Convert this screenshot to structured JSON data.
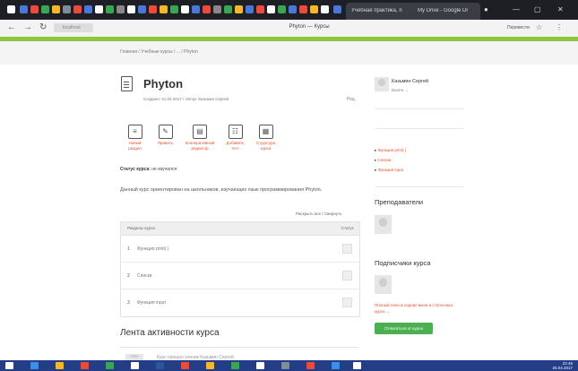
{
  "browser": {
    "active_tab_title": "Учебная практика, п",
    "second_tab_title": "My Drive - Google Dr",
    "address": "localhost",
    "page_title": "Phyton — Курсы",
    "translate_label": "Перевести"
  },
  "breadcrumb": "Главная  /  Учебные курсы  /  ...  /  Phyton",
  "course": {
    "title": "Phyton",
    "meta": "Создано: 21.04.2017  /  Автор: Казьмин Сергей",
    "ref_label": "Ред."
  },
  "actions": [
    {
      "label": "Новый раздел",
      "icon": "new-section-icon",
      "glyph": "≡"
    },
    {
      "label": "Править",
      "icon": "edit-icon",
      "glyph": "✎"
    },
    {
      "label": "Кооперативный редактор",
      "icon": "coop-editor-icon",
      "glyph": "▤"
    },
    {
      "label": "Добавить тест",
      "icon": "add-test-icon",
      "glyph": "☷"
    },
    {
      "label": "Структура курса",
      "icon": "course-structure-icon",
      "glyph": "▦"
    }
  ],
  "status": {
    "label": "Статус курса:",
    "value": "не изучался"
  },
  "description": "Данный курс ориентирован на школьников, изучающих язык программирования Phyton.",
  "expand_link": "Раскрыть все / Свернуть",
  "sections_table": {
    "col_sections": "Разделы курса",
    "col_status": "Статус",
    "rows": [
      {
        "num": "1",
        "name": "Функция print( )"
      },
      {
        "num": "2",
        "name": "Списки"
      },
      {
        "num": "3",
        "name": "Функция input"
      }
    ]
  },
  "feed": {
    "title": "Лента активности курса",
    "snippet": "Курс прошел ученик Казьмин Сергей"
  },
  "sidebar": {
    "user_name": "Казьмин Сергей",
    "user_link": "Выйти  →",
    "links": [
      "Функция print( )",
      "Списки",
      "Функция input"
    ],
    "teachers_title": "Преподаватели",
    "subscribers_title": "Подписчики курса",
    "subscribe_note": "Полный список подписчиков и статистика курса  →",
    "subscribe_button": "Отписаться от курса"
  },
  "taskbar": {
    "time": "22:45",
    "date": "26.04.2017"
  },
  "colors": {
    "accent_green": "#8cc63f",
    "link_orange": "#e2522c",
    "taskbar_blue": "#233e86",
    "button_green": "#4caf50"
  }
}
